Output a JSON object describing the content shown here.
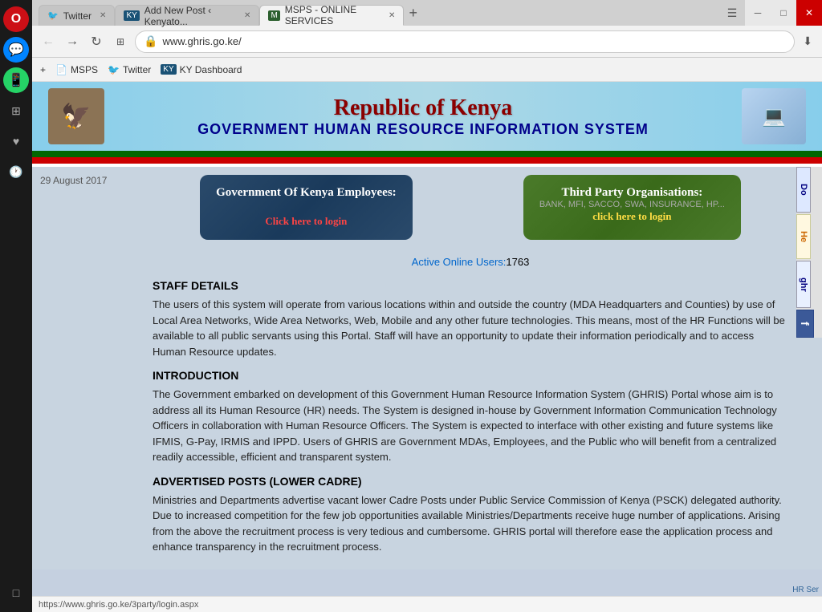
{
  "browser": {
    "tabs": [
      {
        "id": "twitter",
        "label": "Twitter",
        "icon": "🐦",
        "active": false
      },
      {
        "id": "addpost",
        "label": "Add New Post ‹ Kenyato...",
        "icon": "KY",
        "active": false
      },
      {
        "id": "msps",
        "label": "MSPS - ONLINE SERVICES",
        "icon": "M",
        "active": true
      }
    ],
    "address": "www.ghris.go.ke/",
    "bookmarks": [
      {
        "id": "msps",
        "label": "MSPS",
        "icon": "📄"
      },
      {
        "id": "twitter",
        "label": "Twitter",
        "icon": "🐦"
      },
      {
        "id": "ky",
        "label": "KY Dashboard",
        "icon": "KY"
      }
    ]
  },
  "site": {
    "title": "Republic of Kenya",
    "subtitle": "GOVERNMENT HUMAN RESOURCE INFORMATION SYSTEM",
    "header_right_text": "HR Ser"
  },
  "date": "29 August 2017",
  "login": {
    "gov_title": "Government Of Kenya Employees:",
    "gov_link": "Click here to login",
    "third_title": "Third party organisations:",
    "third_subtitle": "BANK, MFI, SACCO, SWA, INSURANCE, HP...",
    "third_link": "click here to login"
  },
  "active_users": {
    "label": "Active Online Users:",
    "count": "1763"
  },
  "sections": [
    {
      "id": "staff",
      "title": "STAFF DETAILS",
      "text": "The users of this system will operate from various locations within and outside the country (MDA Headquarters and Counties) by use of Local Area Networks, Wide Area Networks, Web, Mobile and any other future technologies. This means, most of the HR Functions will be available to all public servants using this Portal. Staff will have an opportunity to update their information periodically and to access Human Resource updates."
    },
    {
      "id": "intro",
      "title": "INTRODUCTION",
      "text": "The Government embarked on development of this Government Human Resource Information System (GHRIS) Portal whose aim is to address all its Human Resource (HR) needs. The System is designed in-house by Government Information Communication Technology Officers in collaboration with Human Resource Officers. The System is expected to interface with other existing and future systems like IFMIS, G-Pay, IRMIS and IPPD. Users of GHRIS are Government MDAs, Employees, and the Public who will benefit from a centralized readily accessible, efficient and transparent system."
    },
    {
      "id": "advertised",
      "title": "ADVERTISED POSTS (LOWER CADRE)",
      "text": "Ministries and Departments advertise vacant lower Cadre Posts under Public Service Commission of Kenya (PSCK) delegated authority. Due to increased competition for the few job opportunities available Ministries/Departments receive huge number of applications. Arising from the above the recruitment process is very tedious and cumbersome. GHRIS portal will therefore ease the application process and enhance transparency in the recruitment process."
    }
  ],
  "right_panel": {
    "download": "Do",
    "help": "He",
    "ghris": "ghr",
    "facebook": "f"
  },
  "status_bar": {
    "url": "https://www.ghris.go.ke/3party/login.aspx"
  },
  "sidebar_icons": {
    "opera": "O",
    "messenger": "m",
    "whatsapp": "W",
    "grid": "⊞",
    "heart": "♥",
    "history": "🕐",
    "bottom": "□"
  }
}
